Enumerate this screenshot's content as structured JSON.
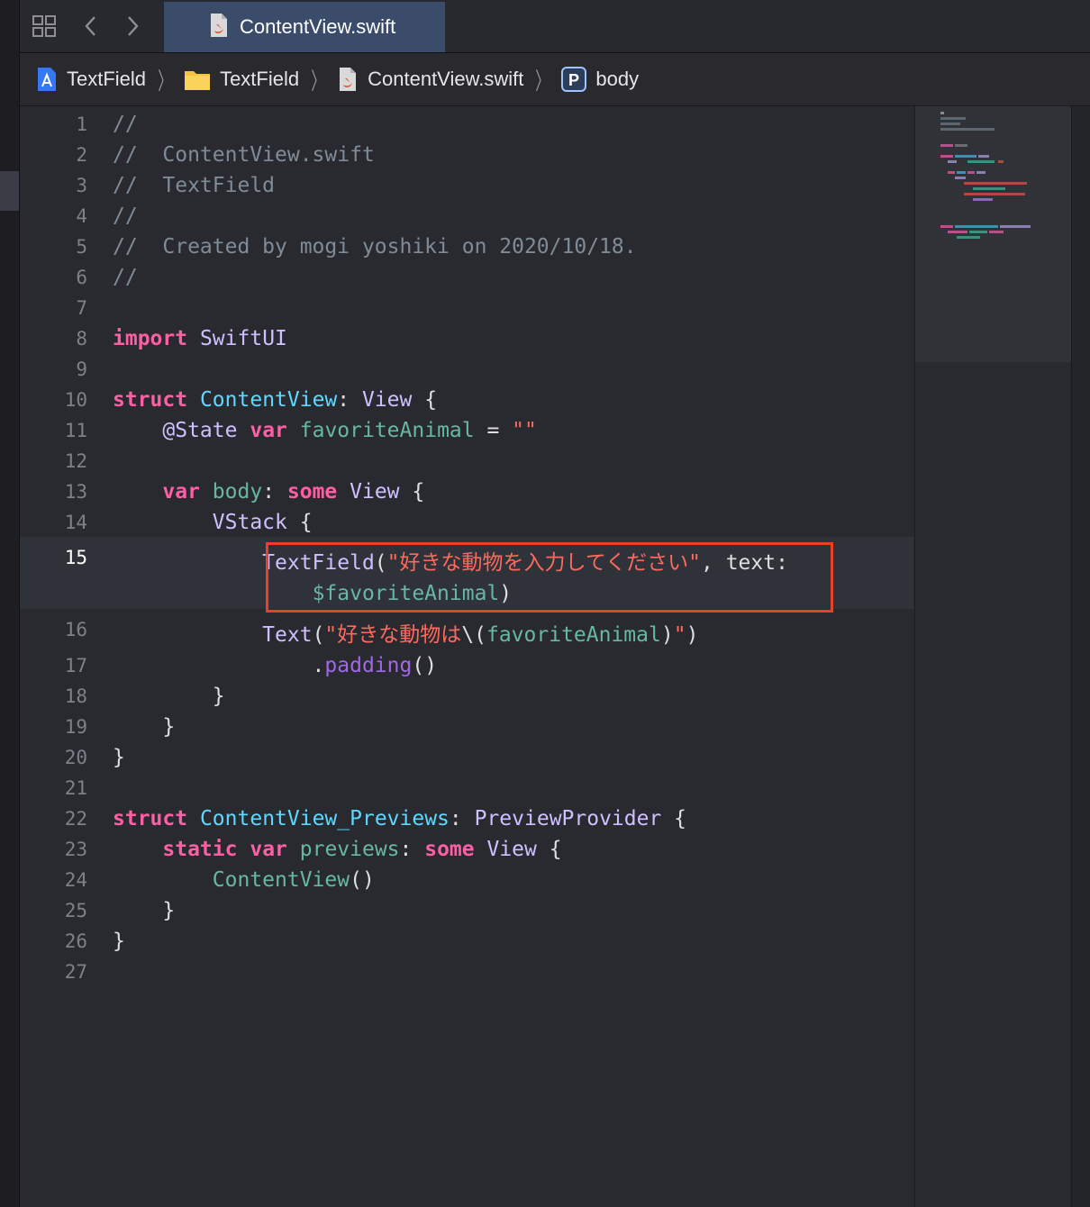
{
  "tabs": [
    {
      "label": "ContentView.swift",
      "icon": "swift-file-icon",
      "active": true
    }
  ],
  "toolbar": {
    "grid_icon": "grid-icon",
    "back_icon": "chevron-left-icon",
    "forward_icon": "chevron-right-icon"
  },
  "breadcrumb": [
    {
      "label": "TextField",
      "icon": "xcode-project-icon"
    },
    {
      "label": "TextField",
      "icon": "folder-icon"
    },
    {
      "label": "ContentView.swift",
      "icon": "swift-file-icon"
    },
    {
      "label": "body",
      "icon": "property-p-icon"
    }
  ],
  "editor": {
    "current_line": 15,
    "lines": [
      {
        "n": "1",
        "text": "//"
      },
      {
        "n": "2",
        "text": "//  ContentView.swift"
      },
      {
        "n": "3",
        "text": "//  TextField"
      },
      {
        "n": "4",
        "text": "//"
      },
      {
        "n": "5",
        "text": "//  Created by mogi yoshiki on 2020/10/18."
      },
      {
        "n": "6",
        "text": "//"
      },
      {
        "n": "7",
        "text": ""
      },
      {
        "n": "8",
        "text": "import SwiftUI"
      },
      {
        "n": "9",
        "text": ""
      },
      {
        "n": "10",
        "text": "struct ContentView: View {"
      },
      {
        "n": "11",
        "text": "    @State var favoriteAnimal = \"\""
      },
      {
        "n": "12",
        "text": ""
      },
      {
        "n": "13",
        "text": "    var body: some View {"
      },
      {
        "n": "14",
        "text": "        VStack {"
      },
      {
        "n": "15",
        "text": "            TextField(\"好きな動物を入力してください\", text:"
      },
      {
        "n": "",
        "text": "                $favoriteAnimal)"
      },
      {
        "n": "16",
        "text": "            Text(\"好きな動物は\\(favoriteAnimal)\")"
      },
      {
        "n": "17",
        "text": "                .padding()"
      },
      {
        "n": "18",
        "text": "        }"
      },
      {
        "n": "19",
        "text": "    }"
      },
      {
        "n": "20",
        "text": "}"
      },
      {
        "n": "21",
        "text": ""
      },
      {
        "n": "22",
        "text": "struct ContentView_Previews: PreviewProvider {"
      },
      {
        "n": "23",
        "text": "    static var previews: some View {"
      },
      {
        "n": "24",
        "text": "        ContentView()"
      },
      {
        "n": "25",
        "text": "    }"
      },
      {
        "n": "26",
        "text": "}"
      },
      {
        "n": "27",
        "text": ""
      }
    ]
  },
  "colors": {
    "comment": "#7f8c98",
    "keyword": "#fc5fa3",
    "type_decl": "#5dd8ff",
    "system_type": "#d0bfff",
    "variable": "#67b7a4",
    "string": "#fc6a5d",
    "function": "#a167e6",
    "highlight_border": "#e7402b",
    "tab_active_bg": "#3b4c6b"
  }
}
